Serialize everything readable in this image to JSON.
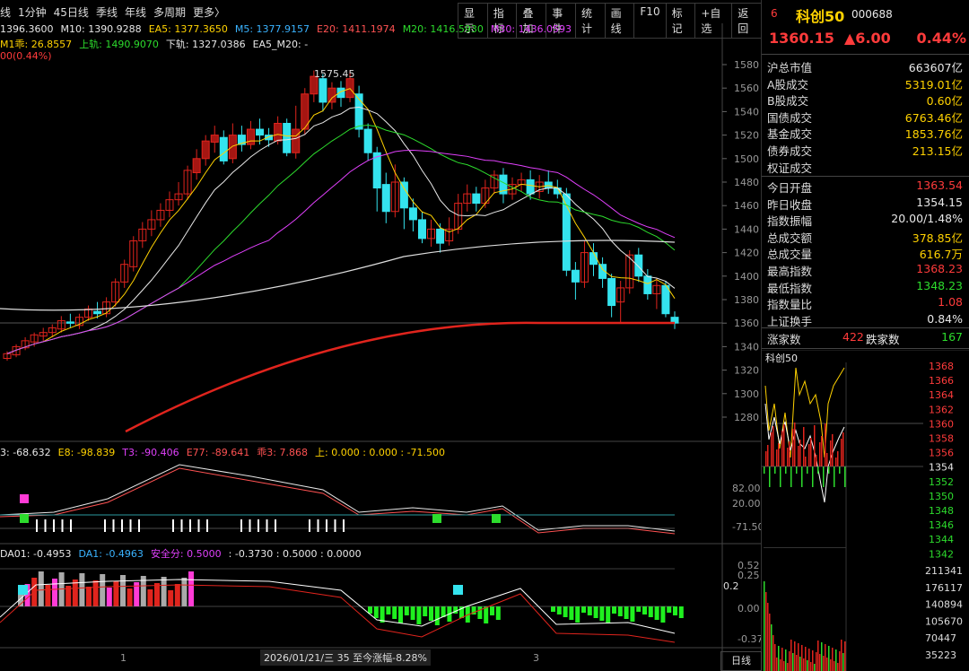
{
  "toolbar": {
    "periods": [
      "线",
      "1分钟",
      "45日线",
      "季线",
      "年线",
      "多周期",
      "更多〉"
    ],
    "buttons": [
      "显示",
      "指标",
      "叠加",
      "事件",
      "统计",
      "画线",
      "F10",
      "标记",
      "+自选",
      "返回"
    ]
  },
  "ma_line1": {
    "items": [
      {
        "text": "1396.3600",
        "color": "#e8e8e8"
      },
      {
        "text": "M10: 1390.9288",
        "color": "#e8e8e8"
      },
      {
        "text": "EA5: 1377.3650",
        "color": "#ffd200"
      },
      {
        "text": "M5: 1377.9157",
        "color": "#3ab3ff"
      },
      {
        "text": "E20: 1411.1974",
        "color": "#ff5252"
      },
      {
        "text": "M20: 1416.5930",
        "color": "#2ddc2d"
      },
      {
        "text": "M30: 1436.0593",
        "color": "#e040fb"
      }
    ]
  },
  "ma_line2": {
    "items": [
      {
        "text": "M1乖: 26.8557",
        "color": "#ffd200"
      },
      {
        "text": "上轨: 1490.9070",
        "color": "#2ddc2d"
      },
      {
        "text": "下轨: 1327.0386",
        "color": "#e8e8e8"
      },
      {
        "text": "EA5_M20: -",
        "color": "#e8e8e8"
      }
    ]
  },
  "pct_line": "00(0.44%)",
  "price_axis": [
    "1580",
    "1560",
    "1540",
    "1520",
    "1500",
    "1480",
    "1460",
    "1440",
    "1420",
    "1400",
    "1380",
    "1360",
    "1340",
    "1320",
    "1300",
    "1280"
  ],
  "high_mark": "1575.45",
  "indicator1": {
    "items": [
      {
        "text": "3: -68.632",
        "color": "#e8e8e8"
      },
      {
        "text": "E8: -98.839",
        "color": "#ffd200"
      },
      {
        "text": "T3: -90.406",
        "color": "#e040fb"
      },
      {
        "text": "E77: -89.641",
        "color": "#ff5252"
      },
      {
        "text": "乖3: 7.868",
        "color": "#ff5252"
      },
      {
        "text": "上: 0.000 : 0.000 : -71.500",
        "color": "#ffd200"
      }
    ],
    "axis": [
      "82.00",
      "20.00",
      "-71.50"
    ]
  },
  "indicator2": {
    "items": [
      {
        "text": "DA01: -0.4953",
        "color": "#e8e8e8"
      },
      {
        "text": "DA1: -0.4963",
        "color": "#3ab3ff"
      },
      {
        "text": "安全分: 0.5000",
        "color": "#e040fb"
      },
      {
        "text": ": -0.3730 : 0.5000 : 0.0000",
        "color": "#e8e8e8"
      }
    ],
    "axis": [
      "0.52",
      "0.25",
      "0.2",
      "0.00",
      "-0.37"
    ]
  },
  "status_bar": "2026/01/21/三 35 至今涨幅-8.28%",
  "x_labels": [
    "1",
    "3"
  ],
  "panel": {
    "index_num": "6",
    "name": "科创50",
    "code": "000688",
    "price": "1360.15",
    "change": "▲6.00",
    "change_pct": "0.44%",
    "rows1": [
      {
        "label": "沪总市值",
        "value": "663607亿",
        "color": "#e8e8e8"
      },
      {
        "label": "A股成交",
        "value": "5319.01亿",
        "color": "#ffd200"
      },
      {
        "label": "B股成交",
        "value": "0.60亿",
        "color": "#ffd200"
      },
      {
        "label": "国债成交",
        "value": "6763.46亿",
        "color": "#ffd200"
      },
      {
        "label": "基金成交",
        "value": "1853.76亿",
        "color": "#ffd200"
      },
      {
        "label": "债券成交",
        "value": "213.15亿",
        "color": "#ffd200"
      },
      {
        "label": "权证成交",
        "value": "",
        "color": "#ffd200"
      }
    ],
    "rows2": [
      {
        "label": "今日开盘",
        "value": "1363.54",
        "color": "#ff3b3b"
      },
      {
        "label": "昨日收盘",
        "value": "1354.15",
        "color": "#e8e8e8"
      },
      {
        "label": "指数振幅",
        "value": "20.00/1.48%",
        "color": "#e8e8e8"
      },
      {
        "label": "总成交额",
        "value": "378.85亿",
        "color": "#ffd200"
      },
      {
        "label": "总成交量",
        "value": "616.7万",
        "color": "#ffd200"
      },
      {
        "label": "最高指数",
        "value": "1368.23",
        "color": "#ff3b3b"
      },
      {
        "label": "最低指数",
        "value": "1348.23",
        "color": "#2ddc2d"
      },
      {
        "label": "指数量比",
        "value": "1.08",
        "color": "#ff3b3b"
      },
      {
        "label": "上证换手",
        "value": "0.84%",
        "color": "#e8e8e8"
      }
    ],
    "up_label": "涨家数",
    "up_count": "422",
    "down_label": "跌家数",
    "down_count": "167",
    "mini_title": "科创50",
    "mini_axis": [
      {
        "v": "1368",
        "c": "#ff3b3b"
      },
      {
        "v": "1366",
        "c": "#ff3b3b"
      },
      {
        "v": "1364",
        "c": "#ff3b3b"
      },
      {
        "v": "1362",
        "c": "#ff3b3b"
      },
      {
        "v": "1360",
        "c": "#ff3b3b"
      },
      {
        "v": "1358",
        "c": "#ff3b3b"
      },
      {
        "v": "1356",
        "c": "#ff3b3b"
      },
      {
        "v": "1354",
        "c": "#e8e8e8"
      },
      {
        "v": "1352",
        "c": "#2ddc2d"
      },
      {
        "v": "1350",
        "c": "#2ddc2d"
      },
      {
        "v": "1348",
        "c": "#2ddc2d"
      },
      {
        "v": "1346",
        "c": "#2ddc2d"
      },
      {
        "v": "1344",
        "c": "#2ddc2d"
      },
      {
        "v": "1342",
        "c": "#2ddc2d"
      }
    ],
    "vol_axis": [
      "211341",
      "176117",
      "140894",
      "105670",
      "70447",
      "35223"
    ],
    "day_tab": "日线"
  }
}
